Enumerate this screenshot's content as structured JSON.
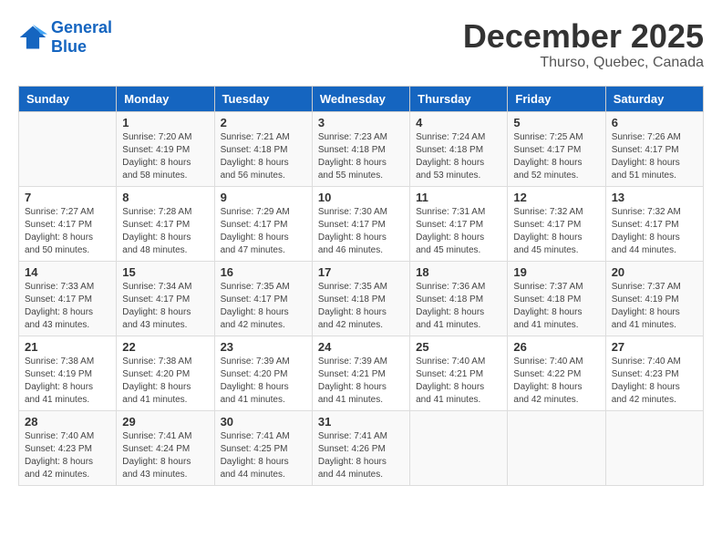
{
  "header": {
    "logo_line1": "General",
    "logo_line2": "Blue",
    "month": "December 2025",
    "location": "Thurso, Quebec, Canada"
  },
  "weekdays": [
    "Sunday",
    "Monday",
    "Tuesday",
    "Wednesday",
    "Thursday",
    "Friday",
    "Saturday"
  ],
  "weeks": [
    [
      {
        "num": "",
        "sunrise": "",
        "sunset": "",
        "daylight": ""
      },
      {
        "num": "1",
        "sunrise": "Sunrise: 7:20 AM",
        "sunset": "Sunset: 4:19 PM",
        "daylight": "Daylight: 8 hours and 58 minutes."
      },
      {
        "num": "2",
        "sunrise": "Sunrise: 7:21 AM",
        "sunset": "Sunset: 4:18 PM",
        "daylight": "Daylight: 8 hours and 56 minutes."
      },
      {
        "num": "3",
        "sunrise": "Sunrise: 7:23 AM",
        "sunset": "Sunset: 4:18 PM",
        "daylight": "Daylight: 8 hours and 55 minutes."
      },
      {
        "num": "4",
        "sunrise": "Sunrise: 7:24 AM",
        "sunset": "Sunset: 4:18 PM",
        "daylight": "Daylight: 8 hours and 53 minutes."
      },
      {
        "num": "5",
        "sunrise": "Sunrise: 7:25 AM",
        "sunset": "Sunset: 4:17 PM",
        "daylight": "Daylight: 8 hours and 52 minutes."
      },
      {
        "num": "6",
        "sunrise": "Sunrise: 7:26 AM",
        "sunset": "Sunset: 4:17 PM",
        "daylight": "Daylight: 8 hours and 51 minutes."
      }
    ],
    [
      {
        "num": "7",
        "sunrise": "Sunrise: 7:27 AM",
        "sunset": "Sunset: 4:17 PM",
        "daylight": "Daylight: 8 hours and 50 minutes."
      },
      {
        "num": "8",
        "sunrise": "Sunrise: 7:28 AM",
        "sunset": "Sunset: 4:17 PM",
        "daylight": "Daylight: 8 hours and 48 minutes."
      },
      {
        "num": "9",
        "sunrise": "Sunrise: 7:29 AM",
        "sunset": "Sunset: 4:17 PM",
        "daylight": "Daylight: 8 hours and 47 minutes."
      },
      {
        "num": "10",
        "sunrise": "Sunrise: 7:30 AM",
        "sunset": "Sunset: 4:17 PM",
        "daylight": "Daylight: 8 hours and 46 minutes."
      },
      {
        "num": "11",
        "sunrise": "Sunrise: 7:31 AM",
        "sunset": "Sunset: 4:17 PM",
        "daylight": "Daylight: 8 hours and 45 minutes."
      },
      {
        "num": "12",
        "sunrise": "Sunrise: 7:32 AM",
        "sunset": "Sunset: 4:17 PM",
        "daylight": "Daylight: 8 hours and 45 minutes."
      },
      {
        "num": "13",
        "sunrise": "Sunrise: 7:32 AM",
        "sunset": "Sunset: 4:17 PM",
        "daylight": "Daylight: 8 hours and 44 minutes."
      }
    ],
    [
      {
        "num": "14",
        "sunrise": "Sunrise: 7:33 AM",
        "sunset": "Sunset: 4:17 PM",
        "daylight": "Daylight: 8 hours and 43 minutes."
      },
      {
        "num": "15",
        "sunrise": "Sunrise: 7:34 AM",
        "sunset": "Sunset: 4:17 PM",
        "daylight": "Daylight: 8 hours and 43 minutes."
      },
      {
        "num": "16",
        "sunrise": "Sunrise: 7:35 AM",
        "sunset": "Sunset: 4:17 PM",
        "daylight": "Daylight: 8 hours and 42 minutes."
      },
      {
        "num": "17",
        "sunrise": "Sunrise: 7:35 AM",
        "sunset": "Sunset: 4:18 PM",
        "daylight": "Daylight: 8 hours and 42 minutes."
      },
      {
        "num": "18",
        "sunrise": "Sunrise: 7:36 AM",
        "sunset": "Sunset: 4:18 PM",
        "daylight": "Daylight: 8 hours and 41 minutes."
      },
      {
        "num": "19",
        "sunrise": "Sunrise: 7:37 AM",
        "sunset": "Sunset: 4:18 PM",
        "daylight": "Daylight: 8 hours and 41 minutes."
      },
      {
        "num": "20",
        "sunrise": "Sunrise: 7:37 AM",
        "sunset": "Sunset: 4:19 PM",
        "daylight": "Daylight: 8 hours and 41 minutes."
      }
    ],
    [
      {
        "num": "21",
        "sunrise": "Sunrise: 7:38 AM",
        "sunset": "Sunset: 4:19 PM",
        "daylight": "Daylight: 8 hours and 41 minutes."
      },
      {
        "num": "22",
        "sunrise": "Sunrise: 7:38 AM",
        "sunset": "Sunset: 4:20 PM",
        "daylight": "Daylight: 8 hours and 41 minutes."
      },
      {
        "num": "23",
        "sunrise": "Sunrise: 7:39 AM",
        "sunset": "Sunset: 4:20 PM",
        "daylight": "Daylight: 8 hours and 41 minutes."
      },
      {
        "num": "24",
        "sunrise": "Sunrise: 7:39 AM",
        "sunset": "Sunset: 4:21 PM",
        "daylight": "Daylight: 8 hours and 41 minutes."
      },
      {
        "num": "25",
        "sunrise": "Sunrise: 7:40 AM",
        "sunset": "Sunset: 4:21 PM",
        "daylight": "Daylight: 8 hours and 41 minutes."
      },
      {
        "num": "26",
        "sunrise": "Sunrise: 7:40 AM",
        "sunset": "Sunset: 4:22 PM",
        "daylight": "Daylight: 8 hours and 42 minutes."
      },
      {
        "num": "27",
        "sunrise": "Sunrise: 7:40 AM",
        "sunset": "Sunset: 4:23 PM",
        "daylight": "Daylight: 8 hours and 42 minutes."
      }
    ],
    [
      {
        "num": "28",
        "sunrise": "Sunrise: 7:40 AM",
        "sunset": "Sunset: 4:23 PM",
        "daylight": "Daylight: 8 hours and 42 minutes."
      },
      {
        "num": "29",
        "sunrise": "Sunrise: 7:41 AM",
        "sunset": "Sunset: 4:24 PM",
        "daylight": "Daylight: 8 hours and 43 minutes."
      },
      {
        "num": "30",
        "sunrise": "Sunrise: 7:41 AM",
        "sunset": "Sunset: 4:25 PM",
        "daylight": "Daylight: 8 hours and 44 minutes."
      },
      {
        "num": "31",
        "sunrise": "Sunrise: 7:41 AM",
        "sunset": "Sunset: 4:26 PM",
        "daylight": "Daylight: 8 hours and 44 minutes."
      },
      {
        "num": "",
        "sunrise": "",
        "sunset": "",
        "daylight": ""
      },
      {
        "num": "",
        "sunrise": "",
        "sunset": "",
        "daylight": ""
      },
      {
        "num": "",
        "sunrise": "",
        "sunset": "",
        "daylight": ""
      }
    ]
  ]
}
